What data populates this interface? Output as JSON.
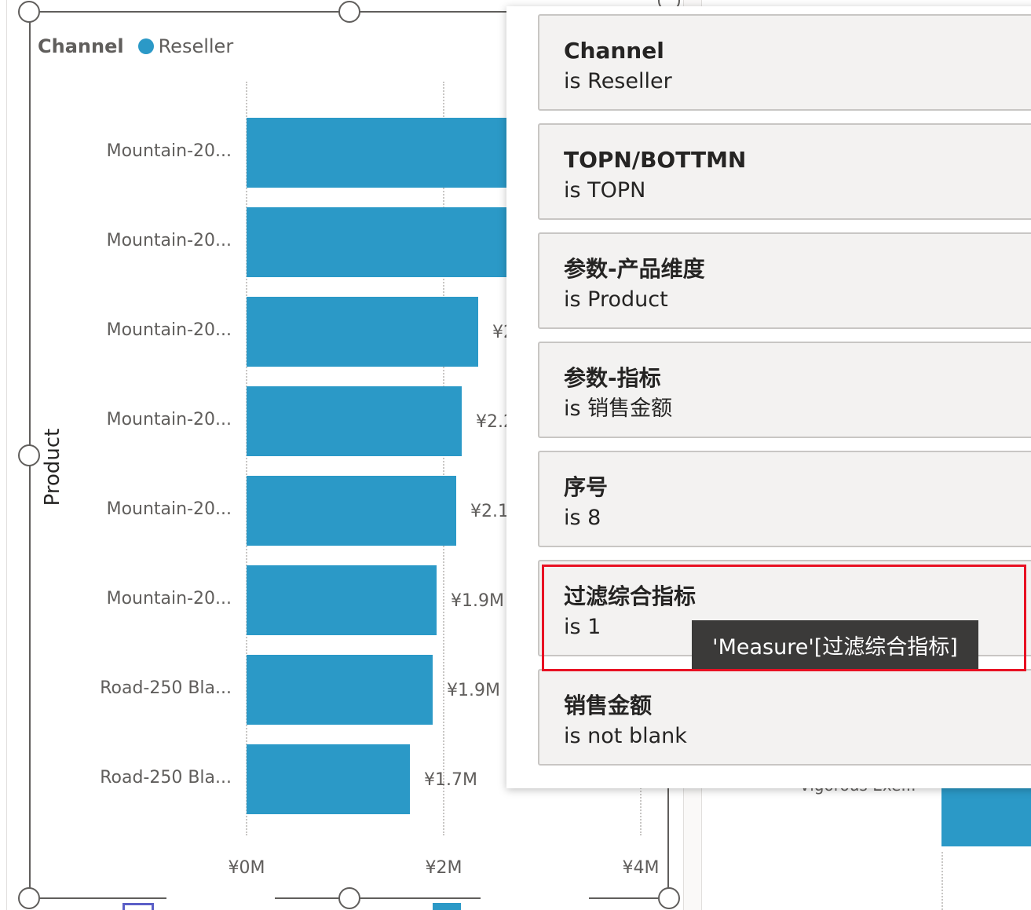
{
  "legend": {
    "title": "Channel",
    "item": "Reseller"
  },
  "y_axis_title": "Product",
  "chart_data": {
    "type": "bar",
    "orientation": "horizontal",
    "categories": [
      "Mountain-20...",
      "Mountain-20...",
      "Mountain-20...",
      "Mountain-20...",
      "Mountain-20...",
      "Mountain-20...",
      "Road-250 Bla...",
      "Road-250 Bla..."
    ],
    "values": [
      2.9,
      2.9,
      2.35,
      2.18,
      2.13,
      1.93,
      1.89,
      1.66
    ],
    "data_labels": [
      "",
      "",
      "¥2",
      "¥2.2",
      "¥2.1",
      "¥1.9M",
      "¥1.9M",
      "¥1.7M"
    ],
    "x_ticks": [
      "¥0M",
      "¥2M",
      "¥4M"
    ],
    "x_tick_values": [
      0,
      2,
      4
    ],
    "xlim": [
      0,
      4
    ],
    "ylabel": "Product",
    "grid": true,
    "color": "#2b99c7"
  },
  "filter_panel": {
    "cards": [
      {
        "name": "Channel",
        "value": "is Reseller"
      },
      {
        "name": "TOPN/BOTTMN",
        "value": "is TOPN"
      },
      {
        "name": "参数-产品维度",
        "value": "is Product"
      },
      {
        "name": "参数-指标",
        "value": "is 销售金额"
      },
      {
        "name": "序号",
        "value": "is 8"
      },
      {
        "name": "过滤综合指标",
        "value": "is 1"
      },
      {
        "name": "销售金额",
        "value": "is not blank"
      }
    ],
    "tooltip": "'Measure'[过滤综合指标]",
    "highlight_color": "#e81123"
  },
  "background_visual": {
    "label": "Vigorous Exe..."
  }
}
